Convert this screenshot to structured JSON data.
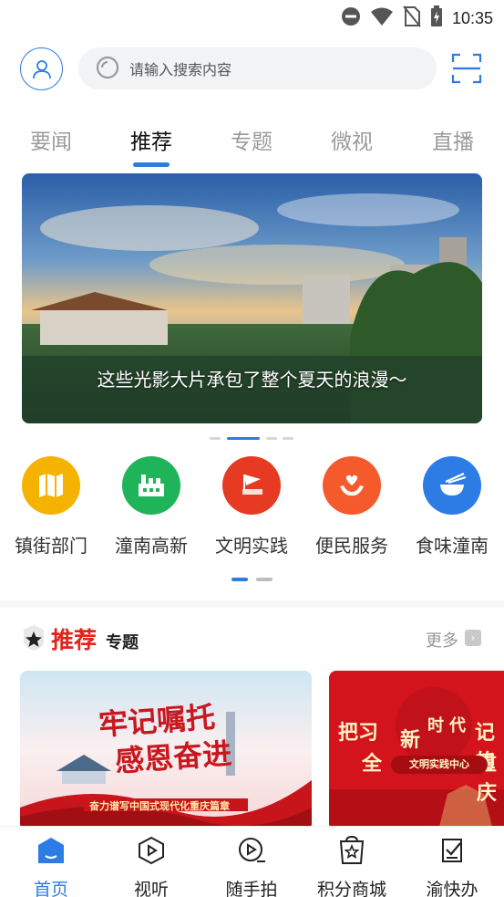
{
  "status_bar": {
    "time": "10:35"
  },
  "header": {
    "search_placeholder": "请输入搜索内容"
  },
  "tabs": [
    {
      "label": "要闻",
      "active": false
    },
    {
      "label": "推荐",
      "active": true
    },
    {
      "label": "专题",
      "active": false
    },
    {
      "label": "微视",
      "active": false
    },
    {
      "label": "直播",
      "active": false
    }
  ],
  "banner": {
    "caption": "这些光影大片承包了整个夏天的浪漫～",
    "active_index": 1,
    "count": 4
  },
  "services": [
    {
      "label": "镇街部门",
      "icon": "map-icon",
      "color": "#f5b300"
    },
    {
      "label": "潼南高新",
      "icon": "factory-icon",
      "color": "#1fb35a"
    },
    {
      "label": "文明实践",
      "icon": "flag-icon",
      "color": "#e63a22"
    },
    {
      "label": "便民服务",
      "icon": "heart-hands-icon",
      "color": "#f55a2c"
    },
    {
      "label": "食味潼南",
      "icon": "bowl-icon",
      "color": "#2d7be5"
    }
  ],
  "section": {
    "title_red": "推荐",
    "title_black": "专题",
    "more_label": "更多"
  },
  "cards": [
    {
      "headline": "牢记嘱托",
      "headline2": "感恩奋进",
      "subtitle": "奋力谱写中国式现代化重庆篇章"
    },
    {
      "headline": "把习",
      "headline_tail": "记的",
      "line2": "全",
      "line2_tail": "重庆",
      "seal_top": "新",
      "seal_top2": "时代",
      "seal_bottom": "文明实践中心"
    }
  ],
  "bottom_nav": [
    {
      "label": "首页",
      "icon": "home-icon",
      "active": true
    },
    {
      "label": "视听",
      "icon": "play-icon",
      "active": false
    },
    {
      "label": "随手拍",
      "icon": "camera-play-icon",
      "active": false
    },
    {
      "label": "积分商城",
      "icon": "shop-star-icon",
      "active": false
    },
    {
      "label": "渝快办",
      "icon": "check-box-icon",
      "active": false
    }
  ],
  "colors": {
    "accent": "#2d7be5",
    "red": "#e2231a"
  }
}
